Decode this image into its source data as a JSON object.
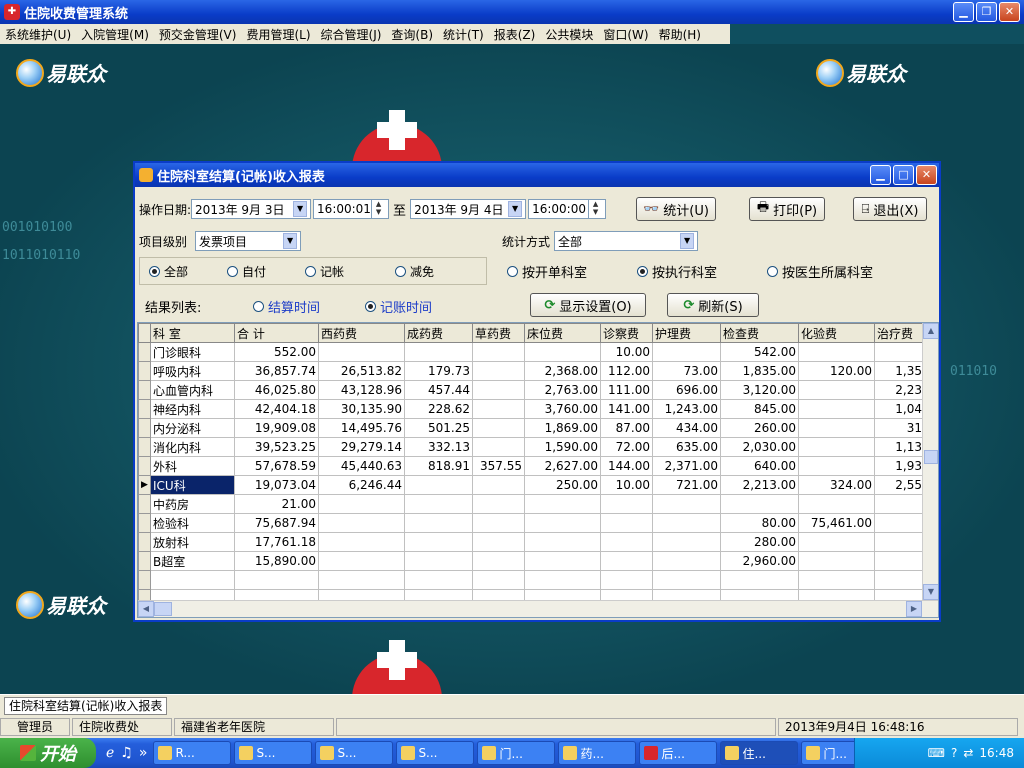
{
  "app": {
    "title": "住院收费管理系统"
  },
  "menu": [
    "系统维护(U)",
    "入院管理(M)",
    "预交金管理(V)",
    "费用管理(L)",
    "综合管理(J)",
    "查询(B)",
    "统计(T)",
    "报表(Z)",
    "公共模块",
    "窗口(W)",
    "帮助(H)"
  ],
  "brand": {
    "logo_text": "易联众"
  },
  "dialog": {
    "title": "住院科室结算(记帐)收入报表",
    "date_label": "操作日期:",
    "date_from": "2013年 9月 3日",
    "time_from": "16:00:01",
    "to_label": "至",
    "date_to": "2013年 9月 4日",
    "time_to": "16:00:00",
    "btn_stat": "统计(U)",
    "btn_print": "打印(P)",
    "btn_exit": "退出(X)",
    "level_label": "项目级别",
    "level_value": "发票项目",
    "method_label": "统计方式",
    "method_value": "全部",
    "filter_radios": [
      "全部",
      "自付",
      "记帐",
      "减免"
    ],
    "dept_radios": [
      "按开单科室",
      "按执行科室",
      "按医生所属科室"
    ],
    "result_label": "结果列表:",
    "result_radios": [
      "结算时间",
      "记账时间"
    ],
    "btn_display": "显示设置(O)",
    "btn_refresh": "刷新(S)"
  },
  "table": {
    "columns": [
      "科 室",
      "合 计",
      "西药费",
      "成药费",
      "草药费",
      "床位费",
      "诊察费",
      "护理费",
      "检查费",
      "化验费",
      "治疗费"
    ],
    "rows": [
      [
        "门诊眼科",
        "552.00",
        "",
        "",
        "",
        "",
        "10.00",
        "",
        "542.00",
        "",
        ""
      ],
      [
        "呼吸内科",
        "36,857.74",
        "26,513.82",
        "179.73",
        "",
        "2,368.00",
        "112.00",
        "73.00",
        "1,835.00",
        "120.00",
        "1,35"
      ],
      [
        "心血管内科",
        "46,025.80",
        "43,128.96",
        "457.44",
        "",
        "2,763.00",
        "111.00",
        "696.00",
        "3,120.00",
        "",
        "2,23"
      ],
      [
        "神经内科",
        "42,404.18",
        "30,135.90",
        "228.62",
        "",
        "3,760.00",
        "141.00",
        "1,243.00",
        "845.00",
        "",
        "1,04"
      ],
      [
        "内分泌科",
        "19,909.08",
        "14,495.76",
        "501.25",
        "",
        "1,869.00",
        "87.00",
        "434.00",
        "260.00",
        "",
        "31"
      ],
      [
        "消化内科",
        "39,523.25",
        "29,279.14",
        "332.13",
        "",
        "1,590.00",
        "72.00",
        "635.00",
        "2,030.00",
        "",
        "1,13"
      ],
      [
        "外科",
        "57,678.59",
        "45,440.63",
        "818.91",
        "357.55",
        "2,627.00",
        "144.00",
        "2,371.00",
        "640.00",
        "",
        "1,93"
      ],
      [
        "ICU科",
        "19,073.04",
        "6,246.44",
        "",
        "",
        "250.00",
        "10.00",
        "721.00",
        "2,213.00",
        "324.00",
        "2,55"
      ],
      [
        "中药房",
        "21.00",
        "",
        "",
        "",
        "",
        "",
        "",
        "",
        "",
        ""
      ],
      [
        "检验科",
        "75,687.94",
        "",
        "",
        "",
        "",
        "",
        "",
        "80.00",
        "75,461.00",
        ""
      ],
      [
        "放射科",
        "17,761.18",
        "",
        "",
        "",
        "",
        "",
        "",
        "280.00",
        "",
        ""
      ],
      [
        "B超室",
        "15,890.00",
        "",
        "",
        "",
        "",
        "",
        "",
        "2,960.00",
        "",
        ""
      ],
      [
        "",
        "",
        "",
        "",
        "",
        "",
        "",
        "",
        "",
        "",
        ""
      ],
      [
        "",
        "",
        "",
        "",
        "",
        "",
        "",
        "",
        "",
        "",
        ""
      ]
    ]
  },
  "status": {
    "tab": "住院科室结算(记帐)收入报表",
    "user": "管理员",
    "dept": "住院收费处",
    "hospital": "福建省老年医院",
    "datetime": "2013年9月4日 16:48:16"
  },
  "taskbar": {
    "start": "开始",
    "tasks": [
      "R...",
      "S...",
      "S...",
      "S...",
      "门...",
      "药...",
      "后...",
      "住...",
      "门..."
    ],
    "clock": "16:48"
  }
}
